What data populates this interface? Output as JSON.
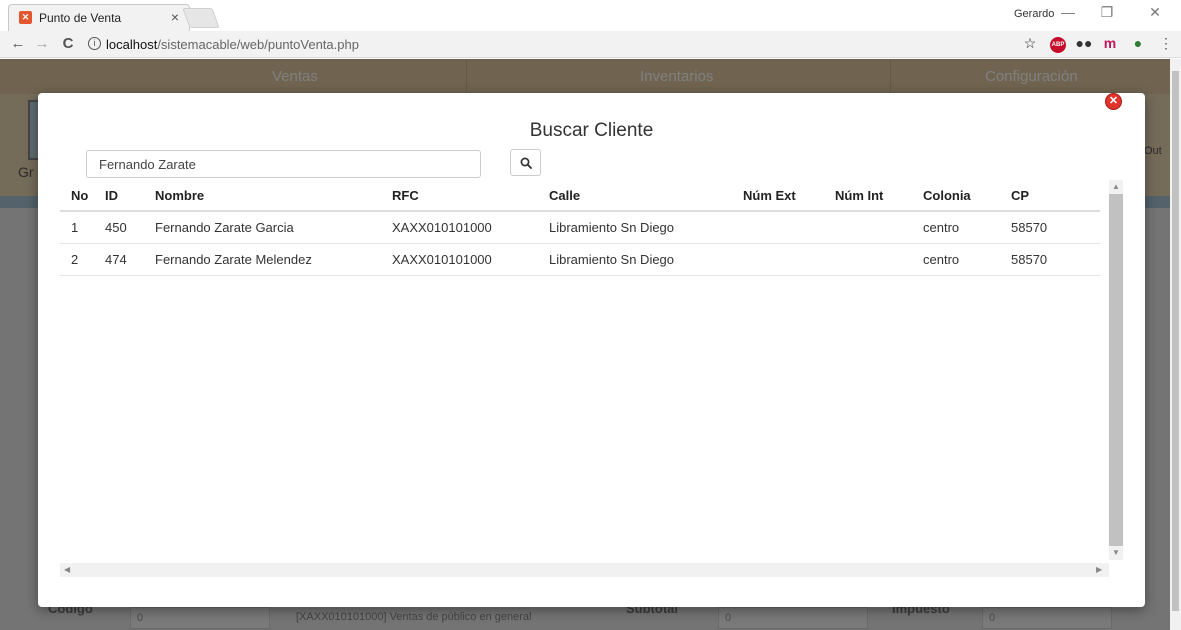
{
  "browser": {
    "tab_title": "Punto de Venta",
    "tab_close": "×",
    "user_name": "Gerardo",
    "url_host": "localhost",
    "url_path": "/sistemacable/web/puntoVenta.php",
    "controls": {
      "minimize": "—",
      "restore": "❐",
      "close": "✕",
      "back": "←",
      "forward": "→",
      "reload": "C",
      "star": "☆",
      "menu": "⋮",
      "abp": "ABP",
      "m_ext": "m"
    }
  },
  "page": {
    "nav": [
      "Ventas",
      "Inventarios",
      "Configuración"
    ],
    "partial_left": "Gr",
    "partial_right": "Out",
    "footer": {
      "codigo_label": "Código",
      "codigo_value": "0",
      "cliente_value": "[XAXX010101000] Ventas de público en general",
      "subtotal_label": "Subtotal",
      "subtotal_value": "0",
      "impuesto_label": "Impuesto",
      "impuesto_value": "0"
    }
  },
  "modal": {
    "title": "Buscar Cliente",
    "search_value": "Fernando Zarate",
    "columns": [
      "No",
      "ID",
      "Nombre",
      "RFC",
      "Calle",
      "Núm Ext",
      "Núm Int",
      "Colonia",
      "CP"
    ],
    "rows": [
      [
        "1",
        "450",
        "Fernando Zarate Garcia",
        "XAXX010101000",
        "Libramiento Sn Diego",
        "",
        "",
        "centro",
        "58570"
      ],
      [
        "2",
        "474",
        "Fernando Zarate Melendez",
        "XAXX010101000",
        "Libramiento Sn Diego",
        "",
        "",
        "centro",
        "58570"
      ]
    ]
  },
  "colors": {
    "accent_page_nav": "#e0c9a0",
    "close_button": "#e0342c"
  }
}
